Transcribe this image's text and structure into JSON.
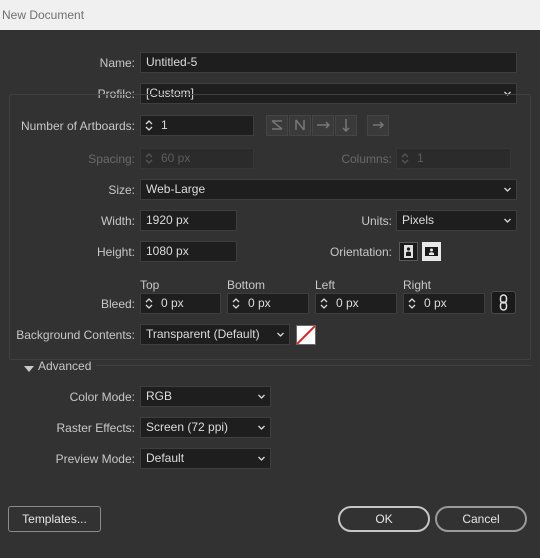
{
  "window": {
    "title": "New Document"
  },
  "name": {
    "label": "Name:",
    "value": "Untitled-5"
  },
  "profile": {
    "label": "Profile:",
    "value": "[Custom]"
  },
  "artboards": {
    "label": "Number of Artboards:",
    "value": "1"
  },
  "spacing": {
    "label": "Spacing:",
    "value": "60 px"
  },
  "columns": {
    "label": "Columns:",
    "value": "1"
  },
  "size": {
    "label": "Size:",
    "value": "Web-Large"
  },
  "width": {
    "label": "Width:",
    "value": "1920 px"
  },
  "units": {
    "label": "Units:",
    "value": "Pixels"
  },
  "height": {
    "label": "Height:",
    "value": "1080 px"
  },
  "orientation": {
    "label": "Orientation:",
    "selected": "landscape"
  },
  "bleed": {
    "label": "Bleed:",
    "top_label": "Top",
    "top": "0 px",
    "bottom_label": "Bottom",
    "bottom": "0 px",
    "left_label": "Left",
    "left": "0 px",
    "right_label": "Right",
    "right": "0 px"
  },
  "background": {
    "label": "Background Contents:",
    "value": "Transparent (Default)"
  },
  "advanced": {
    "label": "Advanced"
  },
  "color_mode": {
    "label": "Color Mode:",
    "value": "RGB"
  },
  "raster": {
    "label": "Raster Effects:",
    "value": "Screen (72 ppi)"
  },
  "preview": {
    "label": "Preview Mode:",
    "value": "Default"
  },
  "buttons": {
    "templates": "Templates...",
    "ok": "OK",
    "cancel": "Cancel"
  },
  "colors": {
    "bg": "#323232",
    "field": "#1e1e1e",
    "text": "#c8c8c8"
  }
}
